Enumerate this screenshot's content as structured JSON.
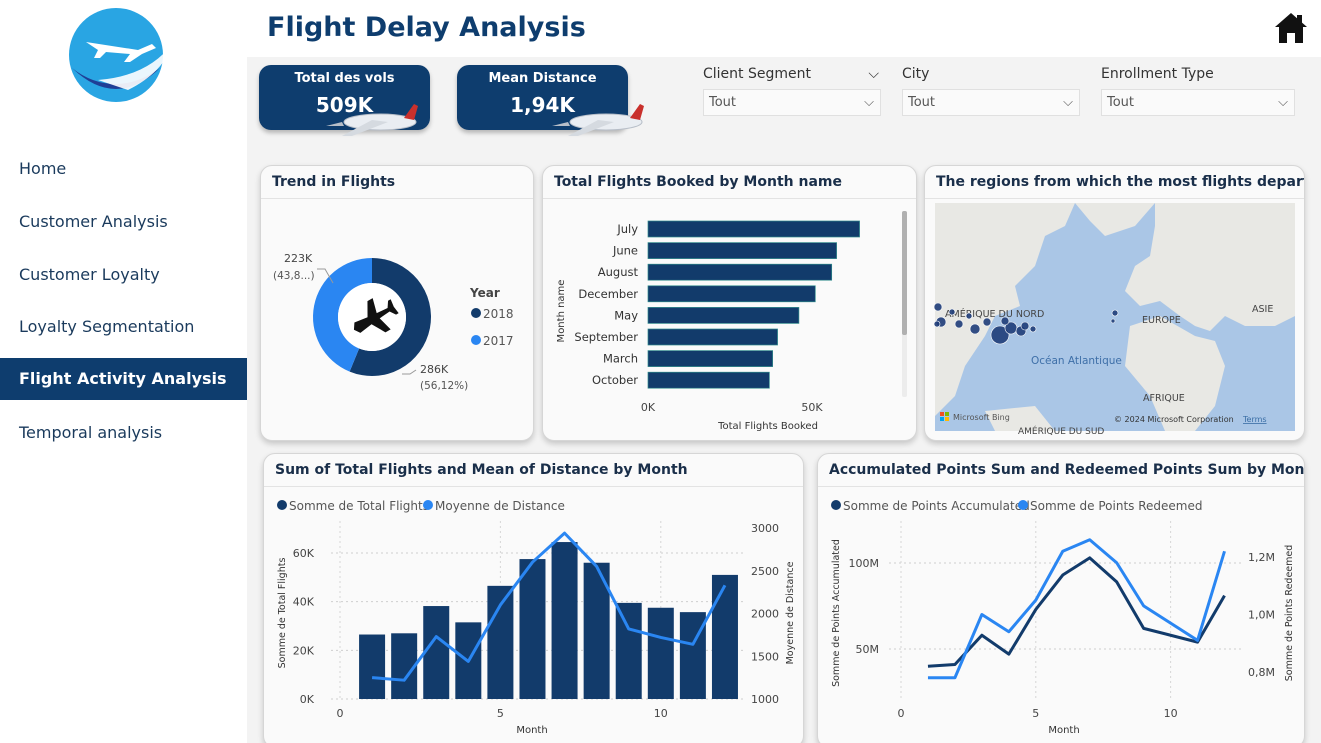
{
  "sidebar": {
    "items": [
      {
        "label": "Home"
      },
      {
        "label": "Customer Analysis"
      },
      {
        "label": "Customer Loyalty"
      },
      {
        "label": "Loyalty Segmentation"
      },
      {
        "label": "Flight Activity Analysis",
        "active": true
      },
      {
        "label": "Temporal analysis"
      }
    ]
  },
  "header": {
    "title": "Flight Delay Analysis",
    "home_icon": "home-icon"
  },
  "kpis": [
    {
      "label": "Total des vols",
      "value": "509K"
    },
    {
      "label": "Mean Distance",
      "value": "1,94K"
    }
  ],
  "filters": [
    {
      "label": "Client Segment",
      "value": "Tout"
    },
    {
      "label": "City",
      "value": "Tout"
    },
    {
      "label": "Enrollment Type",
      "value": "Tout"
    }
  ],
  "colors": {
    "dark": "#123b6b",
    "light": "#2a86f2",
    "nav_active": "#0e3d6e"
  },
  "cards": {
    "donut": {
      "title": "Trend in Flights",
      "legend_title": "Year",
      "label_a_1": "223K",
      "label_a_2": "(43,8...)",
      "label_b_1": "286K",
      "label_b_2": "(56,12%)"
    },
    "bars": {
      "title": "Total Flights Booked by Month name",
      "ylabel": "Month name",
      "xlabel": "Total Flights Booked",
      "x_ticks": [
        "0K",
        "50K"
      ]
    },
    "map": {
      "title": "The regions from which the most flights depart",
      "labels": {
        "north_america": "AMÉRIQUE DU NORD",
        "europe": "EUROPE",
        "asia": "ASIE",
        "ocean": "Océan Atlantique",
        "africa": "AFRIQUE",
        "south_america": "AMÉRIQUE DU SUD"
      },
      "bing": "Microsoft Bing",
      "copyright": "© 2024 Microsoft Corporation",
      "terms": "Terms"
    },
    "combo": {
      "title": "Sum of Total Flights and Mean of Distance by Month",
      "legend": [
        "Somme de Total Flights",
        "Moyenne de Distance"
      ],
      "ylabel_left": "Somme de Total Flights",
      "ylabel_right": "Moyenne de Distance",
      "xlabel": "Month",
      "y_ticks_left": [
        "0K",
        "20K",
        "40K",
        "60K"
      ],
      "y_ticks_right": [
        "1000",
        "1500",
        "2000",
        "2500",
        "3000"
      ],
      "x_ticks": [
        "0",
        "5",
        "10"
      ]
    },
    "points": {
      "title": "Accumulated Points Sum and Redeemed Points Sum by Month",
      "legend": [
        "Somme de Points Accumulated",
        "Somme de Points Redeemed"
      ],
      "ylabel_left": "Somme de Points Accumulated",
      "ylabel_right": "Somme de Points Redeemed",
      "xlabel": "Month",
      "y_ticks_left": [
        "50M",
        "100M"
      ],
      "y_ticks_right": [
        "0,8M",
        "1,0M",
        "1,2M"
      ],
      "x_ticks": [
        "0",
        "5",
        "10"
      ]
    }
  },
  "chart_data": [
    {
      "type": "pie",
      "title": "Trend in Flights",
      "legend_title": "Year",
      "categories": [
        "2018",
        "2017"
      ],
      "values": [
        286000,
        223000
      ],
      "percents": [
        56.12,
        43.88
      ]
    },
    {
      "type": "bar",
      "title": "Total Flights Booked by Month name",
      "orientation": "horizontal",
      "categories": [
        "July",
        "June",
        "August",
        "December",
        "May",
        "September",
        "March",
        "October"
      ],
      "values": [
        64500,
        57500,
        56000,
        51000,
        46000,
        39500,
        38000,
        37000
      ],
      "xlim": [
        0,
        75000
      ]
    },
    {
      "type": "bar",
      "title": "Sum of Total Flights and Mean of Distance by Month",
      "x": [
        1,
        2,
        3,
        4,
        5,
        6,
        7,
        8,
        9,
        10,
        11,
        12
      ],
      "series": [
        {
          "name": "Somme de Total Flights",
          "kind": "bar",
          "axis": "left",
          "values": [
            26500,
            27000,
            38200,
            31500,
            46500,
            57500,
            64500,
            56000,
            39500,
            37500,
            35700,
            51000
          ]
        },
        {
          "name": "Moyenne de Distance",
          "kind": "line",
          "axis": "right",
          "values": [
            1250,
            1220,
            1730,
            1440,
            2100,
            2600,
            2940,
            2550,
            1820,
            1720,
            1640,
            2330
          ]
        }
      ],
      "xlim": [
        0,
        12.5
      ],
      "ylim_left": [
        0,
        72000
      ],
      "ylim_right": [
        1000,
        3000
      ]
    },
    {
      "type": "line",
      "title": "Accumulated Points Sum and Redeemed Points Sum by Month",
      "x": [
        1,
        2,
        3,
        4,
        5,
        6,
        7,
        8,
        9,
        10,
        11,
        12
      ],
      "series": [
        {
          "name": "Somme de Points Accumulated",
          "axis": "left",
          "values": [
            40,
            41,
            58,
            47,
            73,
            93,
            103,
            89,
            62,
            58,
            54,
            81
          ]
        },
        {
          "name": "Somme de Points Redeemed",
          "axis": "right",
          "values": [
            0.78,
            0.78,
            1.0,
            0.94,
            1.05,
            1.22,
            1.26,
            1.18,
            1.03,
            0.97,
            0.91,
            1.22
          ]
        }
      ],
      "xlim": [
        0,
        12.5
      ],
      "ylim_left": [
        20,
        120
      ],
      "ylim_right": [
        0.7,
        1.35
      ]
    }
  ]
}
